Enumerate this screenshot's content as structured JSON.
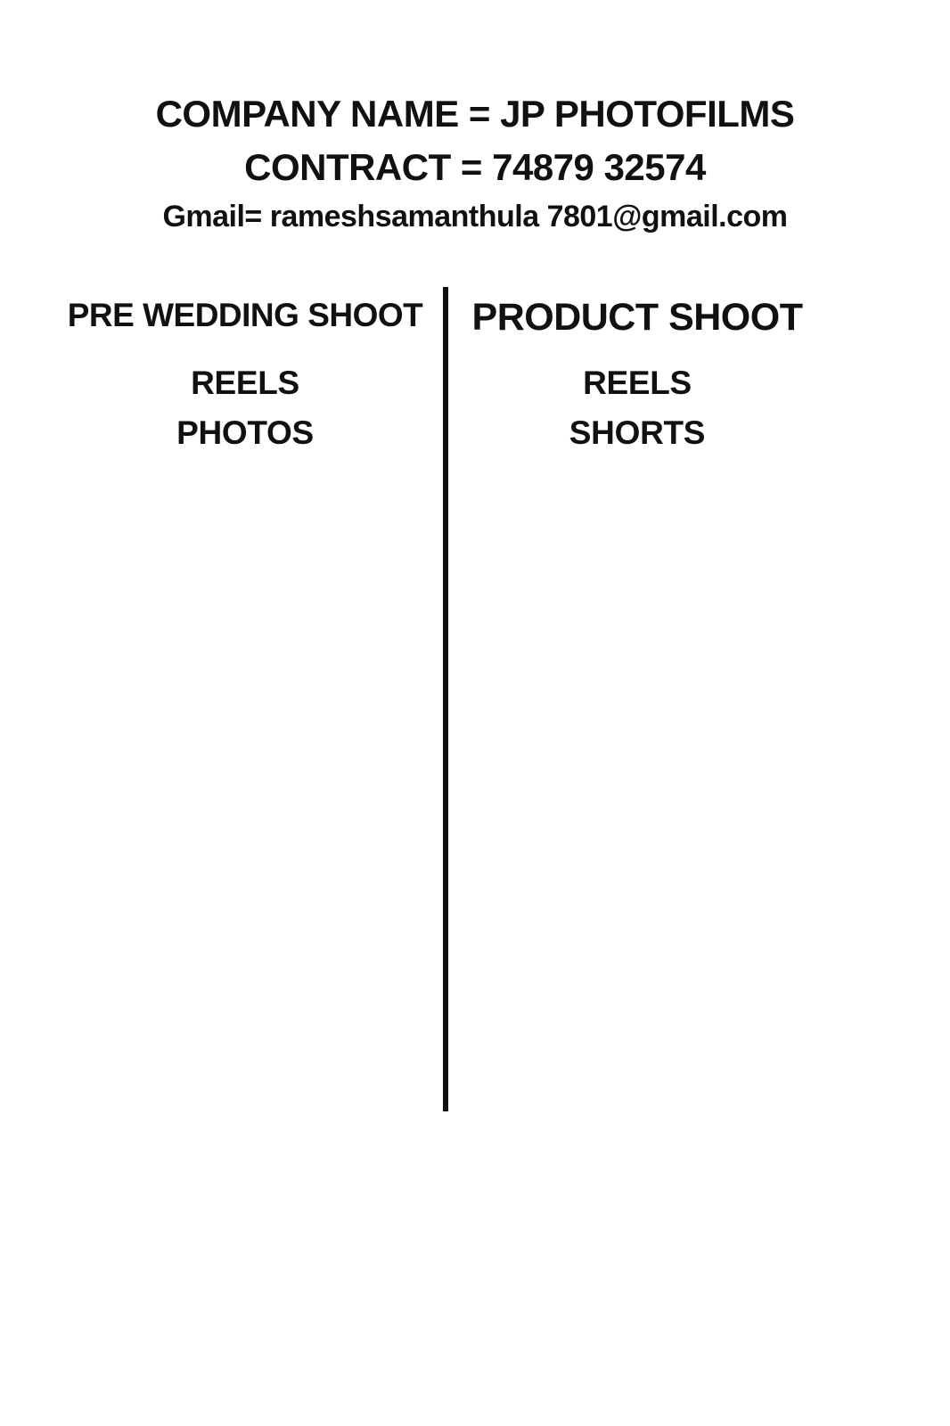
{
  "header": {
    "company": "COMPANY NAME = JP PHOTOFILMS",
    "contract": "CONTRACT  = 74879 32574",
    "gmail": "Gmail= rameshsamanthula 7801@gmail.com"
  },
  "services": [
    {
      "title": "PRE WEDDING SHOOT",
      "items": [
        "REELS",
        "PHOTOS"
      ]
    },
    {
      "title": "PRODUCT SHOOT",
      "items": [
        "REELS",
        "SHORTS"
      ]
    }
  ],
  "colors": {
    "text": "#111111",
    "background": "#ffffff",
    "divider": "#111111"
  }
}
